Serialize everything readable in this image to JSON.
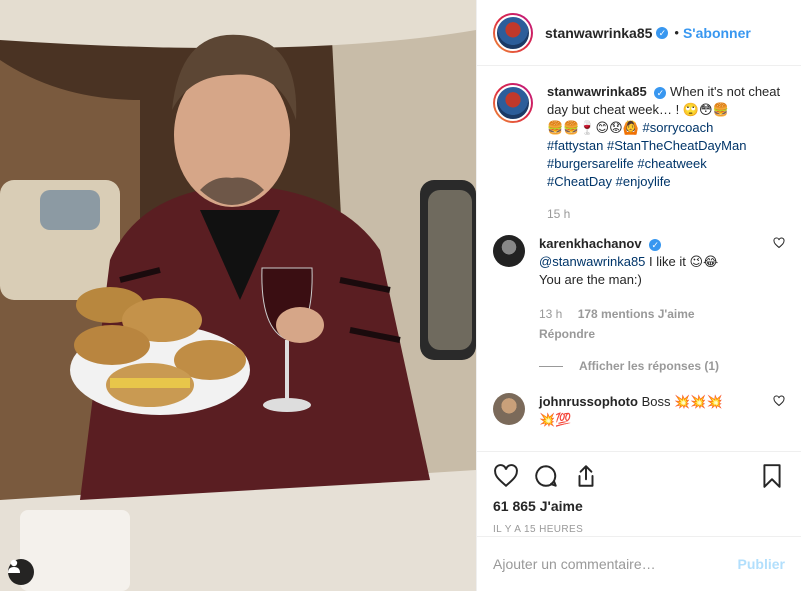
{
  "post": {
    "author": "stanwawrinka85",
    "follow_label": "S'abonner",
    "separator": "•",
    "caption_prefix": "When it's not cheat day but cheat week… ! 🙄😳🍔",
    "caption_emojis": "🍔🍔🍷😊😟🙆",
    "hashtags": [
      "#sorrycoach",
      "#fattystan",
      "#StanTheCheatDayMan",
      "#burgersarelife",
      "#cheatweek",
      "#CheatDay",
      "#enjoylife"
    ],
    "caption_time": "15 h"
  },
  "comments": [
    {
      "user": "karenkhachanov",
      "mention": "@stanwawrinka85",
      "text_line1": " I like it 😉😂",
      "text_line2": "You are the man:)",
      "time": "13 h",
      "likes": "178 mentions J'aime",
      "reply": "Répondre",
      "view_replies": "Afficher les réponses (1)"
    },
    {
      "user": "johnrussophoto",
      "text": "Boss 💥💥💥",
      "text_line2": "💥💯"
    }
  ],
  "actions": {
    "likes_count": "61 865 J'aime",
    "timestamp": "IL Y A 15 HEURES"
  },
  "composer": {
    "placeholder": "Ajouter un commentaire…",
    "publish_label": "Publier"
  },
  "colors": {
    "link": "#3897f0",
    "hashtag": "#003569",
    "muted": "#999999"
  },
  "icons": [
    "user-tag-icon",
    "verified-icon",
    "heart-icon",
    "comment-icon",
    "share-icon",
    "bookmark-icon"
  ]
}
